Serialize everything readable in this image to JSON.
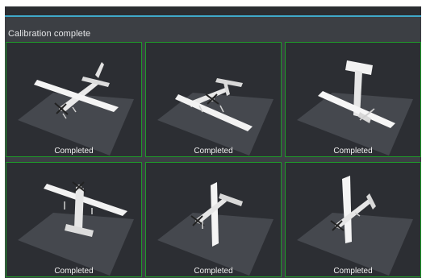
{
  "header": {
    "status_text": "Calibration complete"
  },
  "colors": {
    "accent": "#3fa9c9",
    "tile_border": "#1f9a2a",
    "panel_bg": "#3c3f44",
    "tile_bg": "#2c2e33"
  },
  "tiles": [
    {
      "orientation": "level",
      "status": "Completed"
    },
    {
      "orientation": "upside-down",
      "status": "Completed"
    },
    {
      "orientation": "nose-down",
      "status": "Completed"
    },
    {
      "orientation": "nose-up",
      "status": "Completed"
    },
    {
      "orientation": "left-side",
      "status": "Completed"
    },
    {
      "orientation": "right-side",
      "status": "Completed"
    }
  ]
}
